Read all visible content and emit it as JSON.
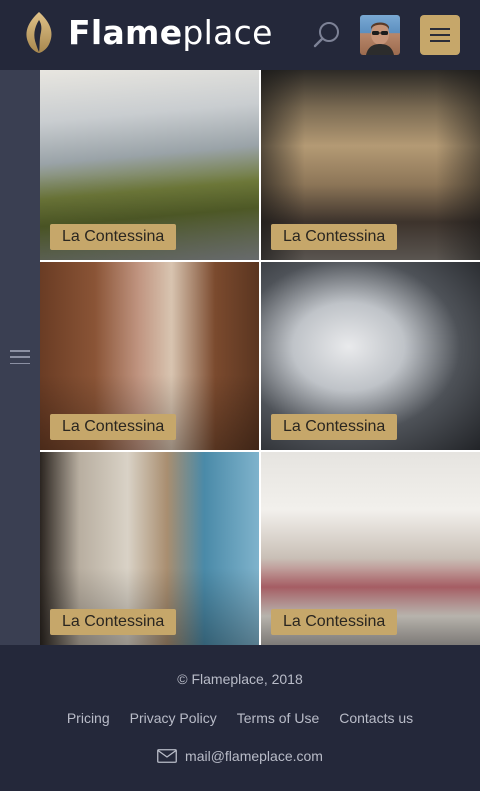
{
  "header": {
    "logo_bold": "Flame",
    "logo_light": "place",
    "search_icon": "search-icon",
    "menu_icon": "hamburger-icon",
    "accent": "#c6a76a"
  },
  "side": {
    "toggle_icon": "hamburger-icon"
  },
  "tiles": [
    {
      "label": "La Contessina"
    },
    {
      "label": "La Contessina"
    },
    {
      "label": "La Contessina"
    },
    {
      "label": "La Contessina"
    },
    {
      "label": "La Contessina"
    },
    {
      "label": "La Contessina"
    }
  ],
  "footer": {
    "copyright": "© Flameplace, 2018",
    "links": [
      "Pricing",
      "Privacy Policy",
      "Terms of Use",
      "Contacts us"
    ],
    "email": "mail@flameplace.com",
    "mail_icon": "mail-icon"
  }
}
